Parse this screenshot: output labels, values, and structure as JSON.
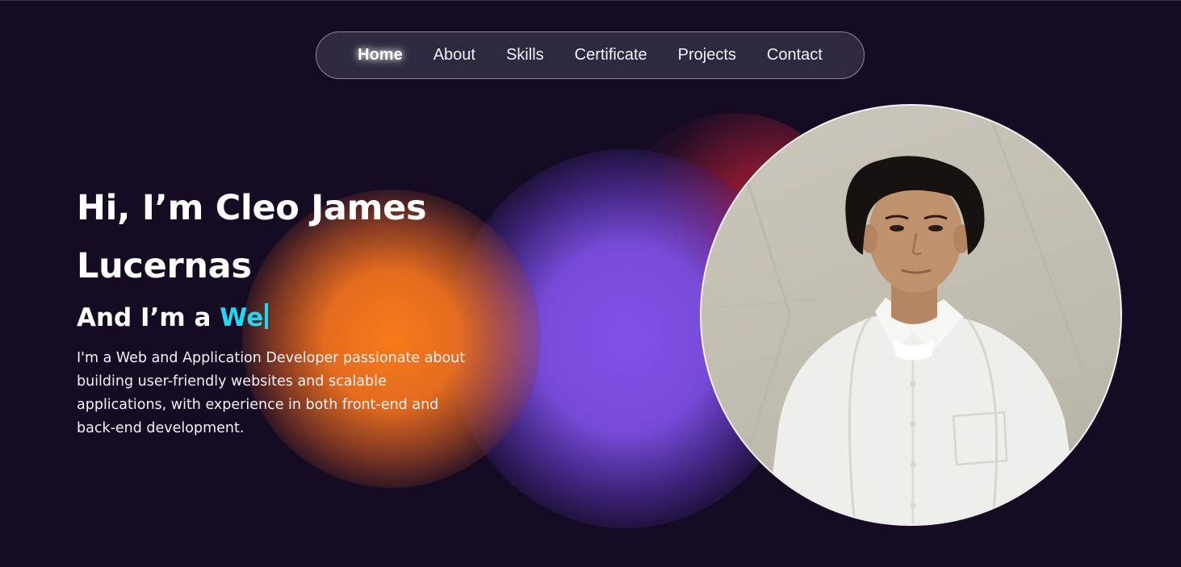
{
  "nav": {
    "items": [
      {
        "label": "Home",
        "active": true
      },
      {
        "label": "About",
        "active": false
      },
      {
        "label": "Skills",
        "active": false
      },
      {
        "label": "Certificate",
        "active": false
      },
      {
        "label": "Projects",
        "active": false
      },
      {
        "label": "Contact",
        "active": false
      }
    ]
  },
  "hero": {
    "name_line_1": "Hi, I’m Cleo James",
    "name_line_2": "Lucernas",
    "role_prefix": "And I’m a ",
    "role_typed": "We",
    "bio": "I'm a Web and Application Developer passionate about building user-friendly websites and scalable applications, with experience in both front-end and back-end development."
  },
  "colors": {
    "background": "#150c24",
    "accent_cyan": "#1fd8f4",
    "glow_orange": "#fa7a1e",
    "glow_purple": "#7f50e6",
    "glow_red": "#e0233a"
  }
}
